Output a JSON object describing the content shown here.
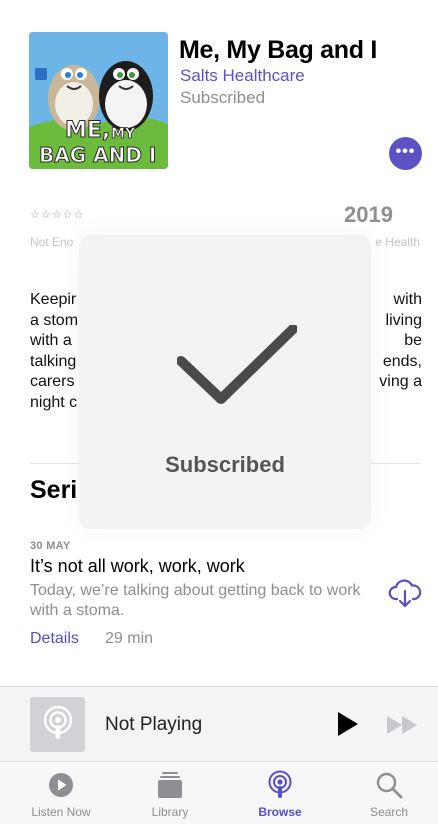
{
  "podcast": {
    "title": "Me, My Bag and I",
    "author": "Salts Healthcare",
    "subscription_status": "Subscribed",
    "artwork_text": "ME, MY BAG AND I",
    "more_label": "•••",
    "rating_stars": "☆☆☆☆☆",
    "year": "2019",
    "ratings_caption": "Not Eno",
    "category_caption": "e Health",
    "description_visible": "Keepir                                                              with\na stom                                                              living\nwith a                                                                    be\ntalking                                                               ends,\ncarers                                                             ving a\nnight c"
  },
  "section": {
    "title": "Seri"
  },
  "episode": {
    "date": "30 MAY",
    "title": "It’s not all work, work, work",
    "summary": "Today, we’re talking about getting back to work with a stoma.",
    "details_label": "Details",
    "duration": "29 min"
  },
  "player": {
    "status": "Not Playing"
  },
  "tabs": [
    {
      "label": "Listen Now",
      "icon": "play-circle-icon",
      "active": false
    },
    {
      "label": "Library",
      "icon": "library-icon",
      "active": false
    },
    {
      "label": "Browse",
      "icon": "podcasts-icon",
      "active": true
    },
    {
      "label": "Search",
      "icon": "search-icon",
      "active": false
    }
  ],
  "hud": {
    "label": "Subscribed"
  },
  "colors": {
    "accent": "#5b4fc4",
    "secondary_text": "#8e8e93"
  }
}
